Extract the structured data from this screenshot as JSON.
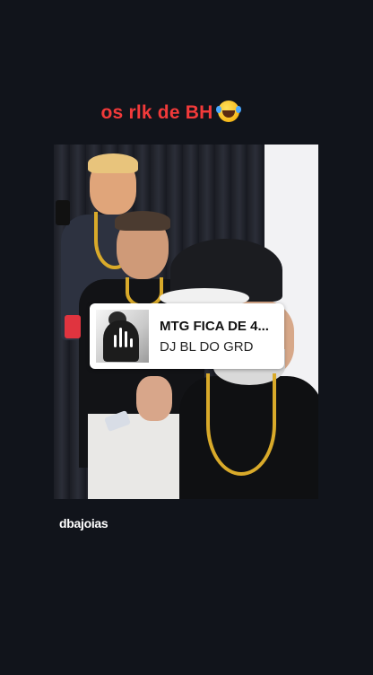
{
  "story": {
    "caption": "os rlk de BH",
    "caption_emoji": "rolling-on-the-floor-laughing",
    "caption_color": "#f23a3a",
    "background_color": "#11141b"
  },
  "music": {
    "title": "MTG FICA DE 4...",
    "artist": "DJ BL DO GRD"
  },
  "watermark": "dbajoias",
  "colors": {
    "sticker_bg": "#ffffff",
    "chain_gold": "#d9aa2a"
  }
}
